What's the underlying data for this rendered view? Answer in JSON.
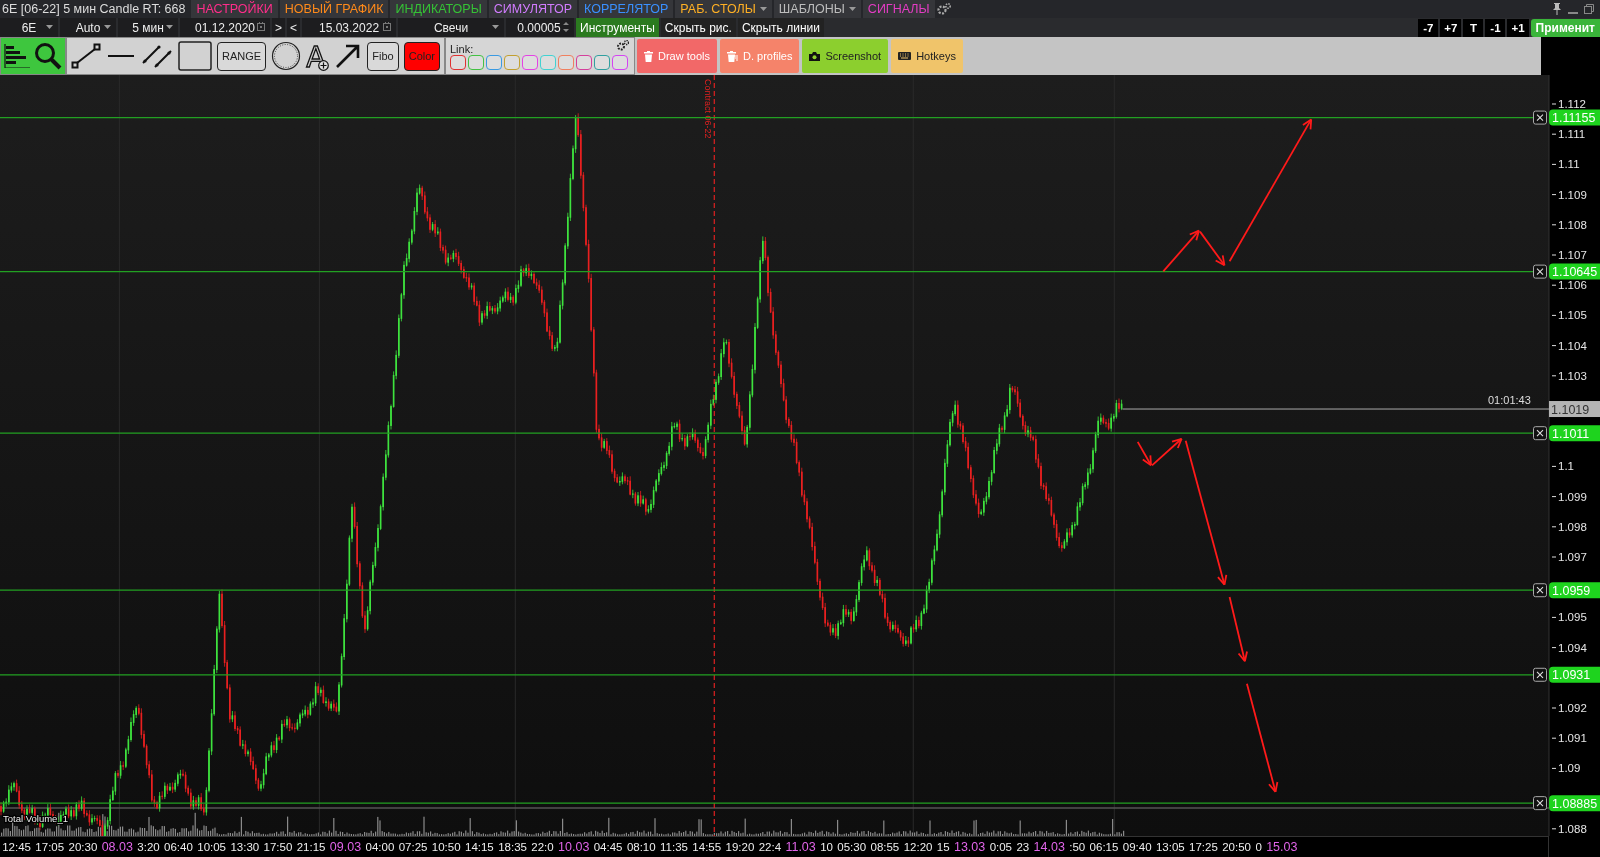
{
  "window": {
    "title": "6E [06-22] 5 мин Candle RT: 668"
  },
  "menu": [
    {
      "label": "НАСТРОЙКИ",
      "color": "#ff2d8a",
      "dropdown": false
    },
    {
      "label": "НОВЫЙ ГРАФИК",
      "color": "#ff8a1a",
      "dropdown": false
    },
    {
      "label": "ИНДИКАТОРЫ",
      "color": "#35c235",
      "dropdown": false
    },
    {
      "label": "СИМУЛЯТОР",
      "color": "#d27cff",
      "dropdown": false
    },
    {
      "label": "КОРРЕЛЯТОР",
      "color": "#3a90ff",
      "dropdown": false
    },
    {
      "label": "РАБ. СТОЛЫ",
      "color": "#ffb024",
      "dropdown": true
    },
    {
      "label": "ШАБЛОНЫ",
      "color": "#bdbdbd",
      "dropdown": true
    },
    {
      "label": "СИГНАЛЫ",
      "color": "#e43cc4",
      "dropdown": false
    }
  ],
  "controls": [
    {
      "kind": "dropdown",
      "value": "6E"
    },
    {
      "kind": "dropdown",
      "value": "Auto"
    },
    {
      "kind": "dropdown",
      "value": "5 мин"
    },
    {
      "kind": "date",
      "value": "01.12.2020"
    },
    {
      "kind": "step",
      "label": ">"
    },
    {
      "kind": "step",
      "label": "<"
    },
    {
      "kind": "date",
      "value": "15.03.2022"
    },
    {
      "kind": "dropdown",
      "value": "Свечи"
    },
    {
      "kind": "spin",
      "value": "0.00005"
    },
    {
      "kind": "toggle",
      "label": "Инструменты",
      "on": true
    },
    {
      "kind": "toggle",
      "label": "Скрыть рис.",
      "on": false
    },
    {
      "kind": "toggle",
      "label": "Скрыть линии",
      "on": false
    }
  ],
  "shift_buttons": [
    "-7",
    "+7",
    "T",
    "-1",
    "+1"
  ],
  "apply_button": "Применит",
  "tools": [
    {
      "kind": "segment"
    },
    {
      "kind": "hline"
    },
    {
      "kind": "channel"
    },
    {
      "kind": "rect"
    },
    {
      "kind": "label",
      "label": "RANGE"
    },
    {
      "kind": "circle"
    },
    {
      "kind": "text",
      "label": "A"
    },
    {
      "kind": "arrow"
    },
    {
      "kind": "label",
      "label": "Fibo"
    },
    {
      "kind": "color",
      "label": "Color",
      "color": "#ff0000"
    }
  ],
  "link": {
    "label": "Link:",
    "colors": [
      {
        "color": "#e03232"
      },
      {
        "color": "#44c244"
      },
      {
        "color": "#3a9ae2"
      },
      {
        "color": "#c2a030"
      },
      {
        "color": "#e442e4"
      },
      {
        "color": "#42d2d2"
      },
      {
        "color": "#f08060"
      },
      {
        "color": "#d4409c"
      },
      {
        "color": "#30a0a0"
      },
      {
        "color": "#d444f2"
      }
    ]
  },
  "actions": [
    {
      "kind": "trash",
      "label": "Draw tools",
      "color": "#f26868"
    },
    {
      "kind": "profile",
      "label": "D. profiles",
      "color": "#f5836a"
    },
    {
      "kind": "camera",
      "label": "Screenshot",
      "color": "#8ccf2e"
    },
    {
      "kind": "keyboard",
      "label": "Hotkeys",
      "color": "#f0c46a"
    }
  ],
  "chart": {
    "contract_marker": "Contract 06-22",
    "price_ticks": [
      "1.112",
      "1.111",
      "1.11",
      "1.109",
      "1.108",
      "1.107",
      "1.106",
      "1.105",
      "1.104",
      "1.103",
      "1.1",
      "1.099",
      "1.098",
      "1.097",
      "1.095",
      "1.094",
      "1.092",
      "1.091",
      "1.09",
      "1.088"
    ],
    "levels": [
      "1.11155",
      "1.10645",
      "1.1011",
      "1.0959",
      "1.0931",
      "1.08885"
    ],
    "last_price": {
      "price": "1.1019",
      "timer": "01:01:43"
    },
    "volume_title": "Total Volume_1",
    "time_labels": [
      {
        "label": "12:45",
        "kind": "time"
      },
      {
        "label": "17:05",
        "kind": "time"
      },
      {
        "label": "20:30",
        "kind": "time"
      },
      {
        "label": "08.03",
        "kind": "date"
      },
      {
        "label": "3:20",
        "kind": "time"
      },
      {
        "label": "06:40",
        "kind": "time"
      },
      {
        "label": "10:05",
        "kind": "time"
      },
      {
        "label": "13:30",
        "kind": "time"
      },
      {
        "label": "17:50",
        "kind": "time"
      },
      {
        "label": "21:15",
        "kind": "time"
      },
      {
        "label": "09.03",
        "kind": "date"
      },
      {
        "label": "04:00",
        "kind": "time"
      },
      {
        "label": "07:25",
        "kind": "time"
      },
      {
        "label": "10:50",
        "kind": "time"
      },
      {
        "label": "14:15",
        "kind": "time"
      },
      {
        "label": "18:35",
        "kind": "time"
      },
      {
        "label": "22:0",
        "kind": "time"
      },
      {
        "label": "10.03",
        "kind": "date"
      },
      {
        "label": "04:45",
        "kind": "time"
      },
      {
        "label": "08:10",
        "kind": "time"
      },
      {
        "label": "11:35",
        "kind": "time"
      },
      {
        "label": "14:55",
        "kind": "time"
      },
      {
        "label": "19:20",
        "kind": "time"
      },
      {
        "label": "22:4",
        "kind": "time"
      },
      {
        "label": "11.03",
        "kind": "date"
      },
      {
        "label": "10",
        "kind": "time"
      },
      {
        "label": "05:30",
        "kind": "time"
      },
      {
        "label": "08:55",
        "kind": "time"
      },
      {
        "label": "12:20",
        "kind": "time"
      },
      {
        "label": "15",
        "kind": "time"
      },
      {
        "label": "13.03",
        "kind": "date"
      },
      {
        "label": "0:05",
        "kind": "time"
      },
      {
        "label": "23",
        "kind": "time"
      },
      {
        "label": "14.03",
        "kind": "date"
      },
      {
        "label": ":50",
        "kind": "time"
      },
      {
        "label": "06:15",
        "kind": "time"
      },
      {
        "label": "09:40",
        "kind": "time"
      },
      {
        "label": "13:05",
        "kind": "time"
      },
      {
        "label": "17:25",
        "kind": "time"
      },
      {
        "label": "20:50",
        "kind": "time"
      },
      {
        "label": "0",
        "kind": "time"
      },
      {
        "label": "15.03",
        "kind": "date"
      }
    ]
  }
}
